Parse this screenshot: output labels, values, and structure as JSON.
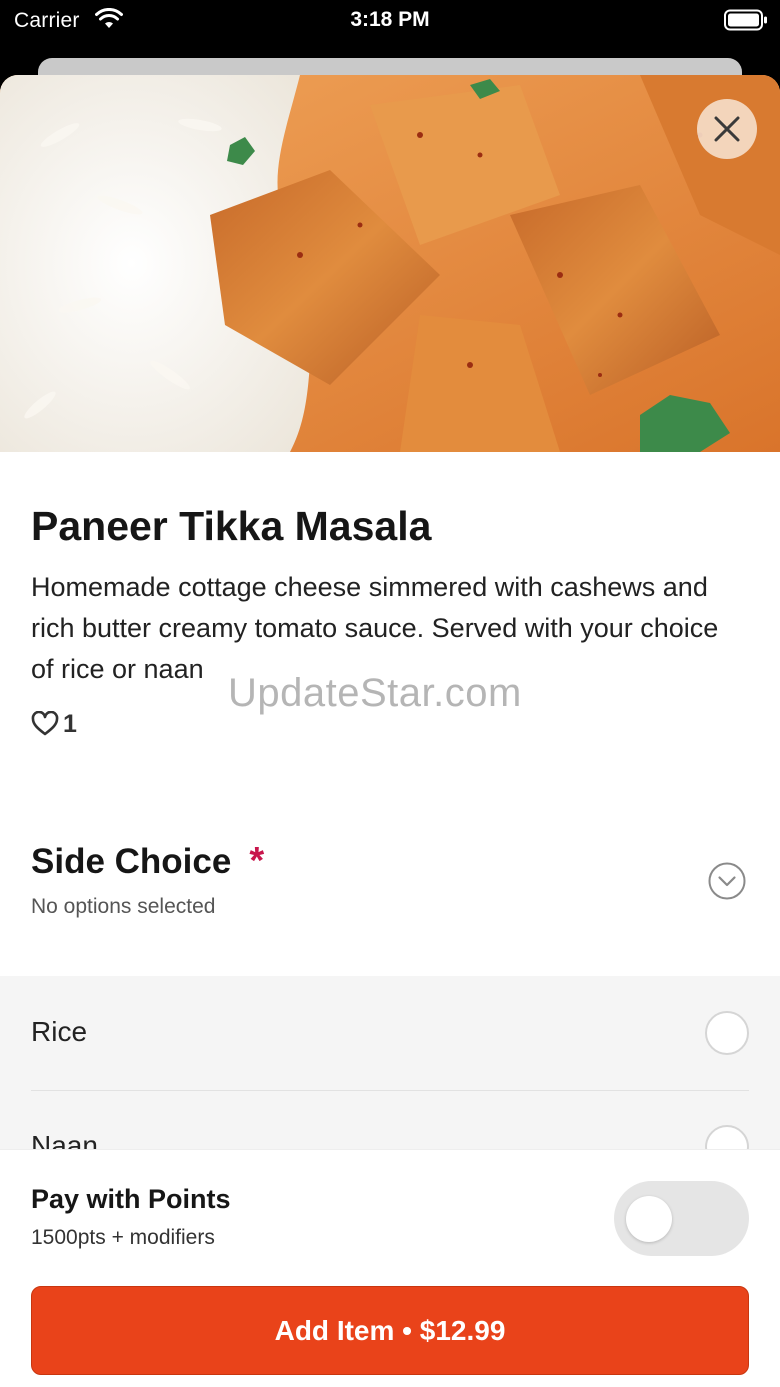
{
  "status_bar": {
    "carrier": "Carrier",
    "time": "3:18 PM"
  },
  "item": {
    "title": "Paneer Tikka Masala",
    "description": "Homemade cottage cheese simmered with cashews and rich butter creamy tomato sauce. Served with your choice of rice or naan",
    "likes": "1"
  },
  "watermark": "UpdateStar.com",
  "side_choice": {
    "title": "Side Choice",
    "required_mark": "*",
    "subtitle": "No options selected",
    "options": [
      {
        "label": "Rice"
      },
      {
        "label": "Naan"
      }
    ]
  },
  "footer": {
    "pay_title": "Pay with Points",
    "pay_sub": "1500pts + modifiers",
    "toggle_on": false,
    "add_button": "Add Item • $12.99"
  },
  "colors": {
    "accent": "#e9431a",
    "required": "#c8164c",
    "options_bg": "#f5f5f5"
  },
  "icons": {
    "close": "close-icon",
    "heart": "heart-icon",
    "chevron": "chevron-down-icon"
  }
}
